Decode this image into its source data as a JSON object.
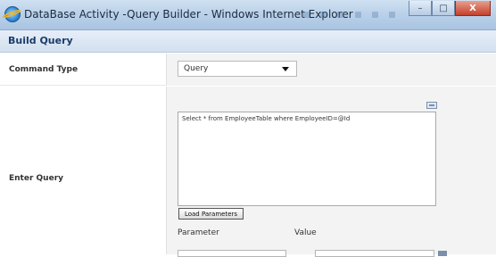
{
  "window": {
    "title": "DataBase Activity -Query Builder - Windows Internet Explorer",
    "minimize_glyph": "–",
    "maximize_glyph": "□",
    "close_glyph": "X"
  },
  "header": {
    "title": "Build Query"
  },
  "command_type": {
    "label": "Command Type",
    "selected": "Query"
  },
  "query": {
    "label": "Enter Query",
    "text": "Select * from EmployeeTable where EmployeeID=@Id"
  },
  "parameters": {
    "load_button": "Load Parameters",
    "col_parameter": "Parameter",
    "col_value": "Value"
  }
}
